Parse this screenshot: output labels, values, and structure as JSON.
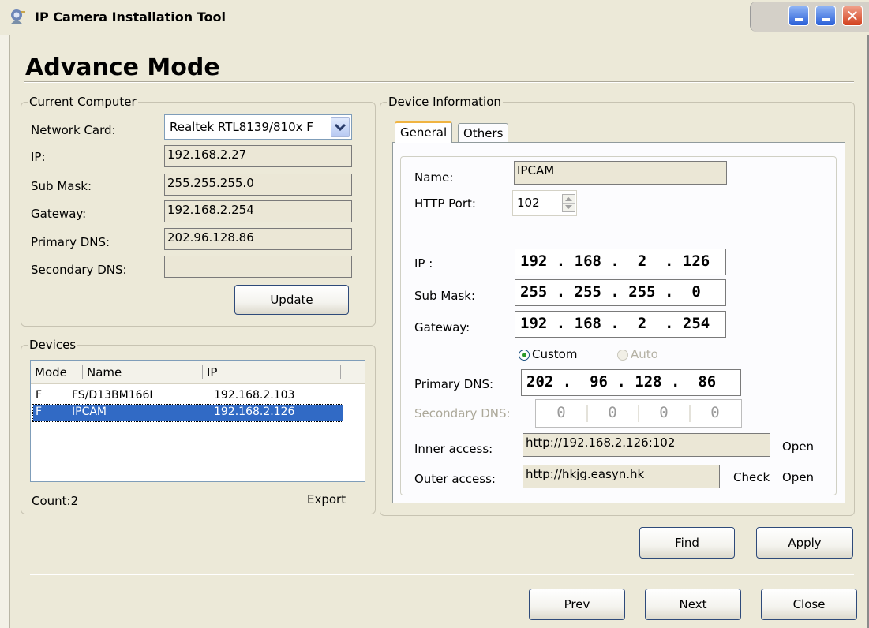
{
  "window": {
    "title": "IP Camera Installation Tool"
  },
  "heading": "Advance Mode",
  "current_computer": {
    "legend": "Current Computer",
    "network_card_label": "Network Card:",
    "network_card_value": "Realtek RTL8139/810x F",
    "ip_label": "IP:",
    "ip_value": "192.168.2.27",
    "sub_mask_label": "Sub Mask:",
    "sub_mask_value": "255.255.255.0",
    "gateway_label": "Gateway:",
    "gateway_value": "192.168.2.254",
    "primary_dns_label": "Primary DNS:",
    "primary_dns_value": "202.96.128.86",
    "secondary_dns_label": "Secondary DNS:",
    "secondary_dns_value": "",
    "update_button": "Update"
  },
  "devices": {
    "legend": "Devices",
    "columns": [
      "Mode",
      "Name",
      "IP"
    ],
    "rows": [
      {
        "mode": "F",
        "name": "FS/D13BM166I",
        "ip": "192.168.2.103",
        "selected": false
      },
      {
        "mode": "F",
        "name": "IPCAM",
        "ip": "192.168.2.126",
        "selected": true
      }
    ],
    "count_text": "Count:2",
    "export_link": "Export"
  },
  "device_info": {
    "legend": "Device Information",
    "tabs": [
      "General",
      "Others"
    ],
    "active_tab": "General",
    "name_label": "Name:",
    "name_value": "IPCAM",
    "http_port_label": "HTTP Port:",
    "http_port_value": "102",
    "ip_label": "IP :",
    "ip_value": "192 . 168 .  2  . 126",
    "sub_mask_label": "Sub Mask:",
    "sub_mask_value": "255 . 255 . 255 .  0",
    "gateway_label": "Gateway:",
    "gateway_value": "192 . 168 .  2  . 254",
    "dns_mode_options": [
      "Custom",
      "Auto"
    ],
    "dns_mode_selected": "Custom",
    "primary_dns_label": "Primary DNS:",
    "primary_dns_value": "202 .  96 . 128 .  86",
    "secondary_dns_label": "Secondary DNS:",
    "secondary_dns_octets": [
      "0",
      "0",
      "0",
      "0"
    ],
    "inner_access_label": "Inner access:",
    "inner_access_value": "http://192.168.2.126:102",
    "inner_open_link": "Open",
    "outer_access_label": "Outer access:",
    "outer_access_value": "http://hkjg.easyn.hk",
    "outer_check_link": "Check",
    "outer_open_link": "Open"
  },
  "buttons": {
    "find": "Find",
    "apply": "Apply",
    "prev": "Prev",
    "next": "Next",
    "close": "Close"
  },
  "colors": {
    "window_bg": "#ece9d8",
    "selection": "#316ac5",
    "readonly_field": "#ebe7d6"
  }
}
